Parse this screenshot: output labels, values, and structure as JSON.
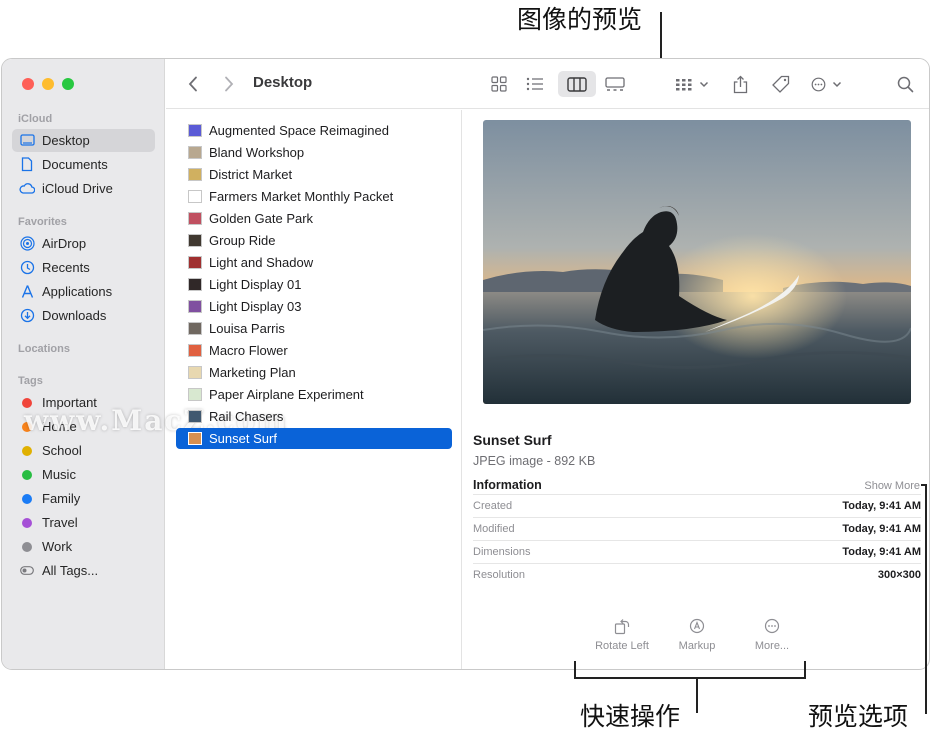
{
  "callouts": {
    "image_preview": "图像的预览",
    "quick_actions": "快速操作",
    "preview_options": "预览选项"
  },
  "window": {
    "title": "Desktop",
    "colors": {
      "selection": "#0a63d8",
      "sidebar_bg": "#e9e9eb"
    }
  },
  "sidebar": {
    "sections": {
      "icloud": "iCloud",
      "favorites": "Favorites",
      "locations": "Locations",
      "tags": "Tags"
    },
    "icloud_items": [
      {
        "label": "Desktop",
        "icon": "desktop-icon"
      },
      {
        "label": "Documents",
        "icon": "document-icon"
      },
      {
        "label": "iCloud Drive",
        "icon": "cloud-icon"
      }
    ],
    "favorite_items": [
      {
        "label": "AirDrop",
        "icon": "airdrop-icon"
      },
      {
        "label": "Recents",
        "icon": "clock-icon"
      },
      {
        "label": "Applications",
        "icon": "applications-icon"
      },
      {
        "label": "Downloads",
        "icon": "download-icon"
      }
    ],
    "tags": [
      {
        "label": "Important",
        "color": "#f0443a"
      },
      {
        "label": "Home",
        "color": "#f7821b"
      },
      {
        "label": "School",
        "color": "#e0b000"
      },
      {
        "label": "Music",
        "color": "#28bd42"
      },
      {
        "label": "Family",
        "color": "#1b7cf5"
      },
      {
        "label": "Travel",
        "color": "#a550d6"
      },
      {
        "label": "Work",
        "color": "#8e8e93"
      }
    ],
    "all_tags": "All Tags..."
  },
  "files": [
    {
      "name": "Augmented Space Reimagined",
      "thumb": "#5b5bd6"
    },
    {
      "name": "Bland Workshop",
      "thumb": "#b8a890"
    },
    {
      "name": "District Market",
      "thumb": "#d0b060"
    },
    {
      "name": "Farmers Market Monthly Packet",
      "thumb": "#ffffff"
    },
    {
      "name": "Golden Gate Park",
      "thumb": "#c05060"
    },
    {
      "name": "Group Ride",
      "thumb": "#403830"
    },
    {
      "name": "Light and Shadow",
      "thumb": "#a03030"
    },
    {
      "name": "Light Display 01",
      "thumb": "#302828"
    },
    {
      "name": "Light Display 03",
      "thumb": "#8050a0"
    },
    {
      "name": "Louisa Parris",
      "thumb": "#706860"
    },
    {
      "name": "Macro Flower",
      "thumb": "#e06040"
    },
    {
      "name": "Marketing Plan",
      "thumb": "#e8d8b0"
    },
    {
      "name": "Paper Airplane Experiment",
      "thumb": "#d8e8d0"
    },
    {
      "name": "Rail Chasers",
      "thumb": "#405870"
    },
    {
      "name": "Sunset Surf",
      "thumb": "#d89050"
    }
  ],
  "preview": {
    "name": "Sunset Surf",
    "type": "JPEG image - 892 KB",
    "info_heading": "Information",
    "show_more": "Show More",
    "info": [
      {
        "key": "Created",
        "value": "Today, 9:41 AM"
      },
      {
        "key": "Modified",
        "value": "Today, 9:41 AM"
      },
      {
        "key": "Dimensions",
        "value": "Today, 9:41 AM"
      },
      {
        "key": "Resolution",
        "value": "300×300"
      }
    ],
    "quick_actions": [
      {
        "label": "Rotate Left",
        "icon": "rotate-left-icon"
      },
      {
        "label": "Markup",
        "icon": "markup-icon"
      },
      {
        "label": "More...",
        "icon": "more-icon"
      }
    ]
  },
  "watermark": "www.MacZ.com"
}
